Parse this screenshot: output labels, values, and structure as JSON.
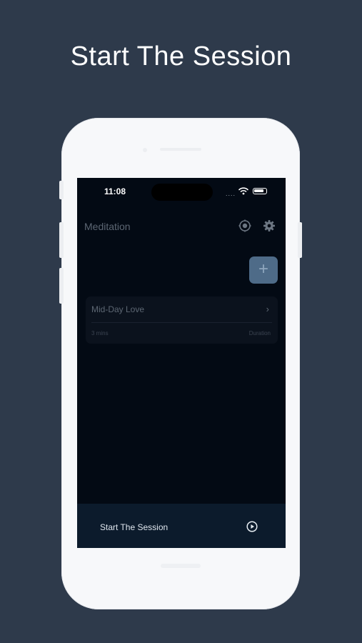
{
  "hero": {
    "title": "Start The Session"
  },
  "status_bar": {
    "time": "11:08",
    "signal": "....",
    "icons": [
      "wifi-icon",
      "battery-icon"
    ]
  },
  "app": {
    "title": "Meditation",
    "header_icons": [
      "timer-settings-icon",
      "gear-icon"
    ],
    "add_button_label": "+"
  },
  "sessions": [
    {
      "title": "Mid-Day Love",
      "duration": "3 mins",
      "duration_label": "Duration"
    }
  ],
  "bottom_bar": {
    "label": "Start The Session",
    "icon": "play-icon"
  },
  "colors": {
    "page_background": "#2e3a4b",
    "screen_background": "#030a14",
    "accent": "#4e6b88",
    "bottom_bar": "#0c1b2c"
  }
}
